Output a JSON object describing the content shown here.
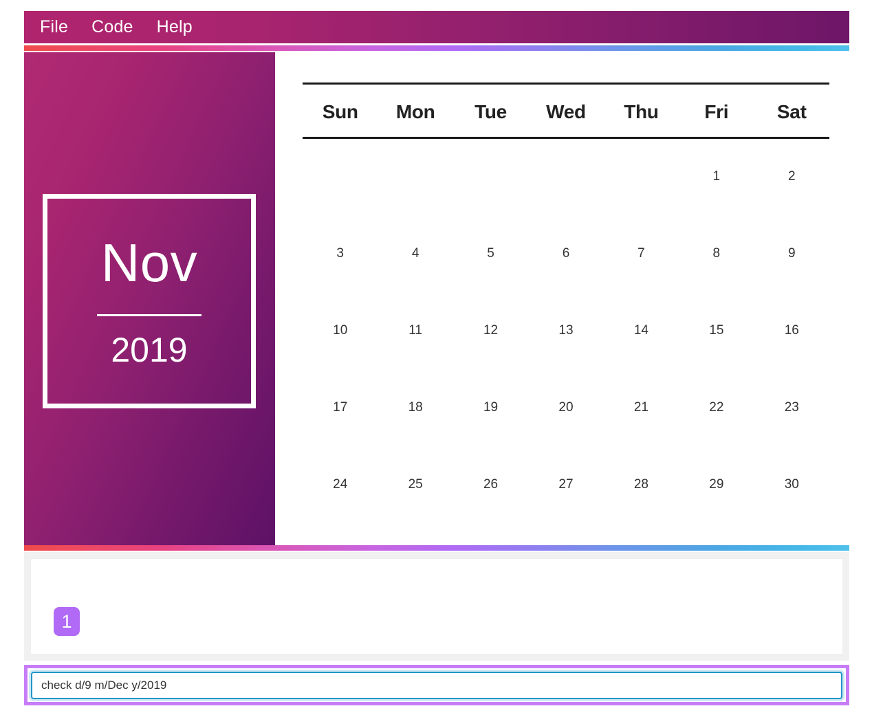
{
  "menubar": {
    "items": [
      {
        "label": "File"
      },
      {
        "label": "Code"
      },
      {
        "label": "Help"
      }
    ]
  },
  "sidebar": {
    "month": "Nov",
    "year": "2019"
  },
  "calendar": {
    "weekday_headers": [
      "Sun",
      "Mon",
      "Tue",
      "Wed",
      "Thu",
      "Fri",
      "Sat"
    ],
    "weeks": [
      [
        "",
        "",
        "",
        "",
        "",
        "1",
        "2"
      ],
      [
        "3",
        "4",
        "5",
        "6",
        "7",
        "8",
        "9"
      ],
      [
        "10",
        "11",
        "12",
        "13",
        "14",
        "15",
        "16"
      ],
      [
        "17",
        "18",
        "19",
        "20",
        "21",
        "22",
        "23"
      ],
      [
        "24",
        "25",
        "26",
        "27",
        "28",
        "29",
        "30"
      ]
    ]
  },
  "output": {
    "badge": "1"
  },
  "command": {
    "value": "check d/9 m/Dec y/2019",
    "placeholder": ""
  },
  "colors": {
    "menubar_start": "#b0246e",
    "menubar_end": "#6e1668",
    "sidebar_start": "#b02a73",
    "sidebar_end": "#5d1266",
    "gradient_red": "#ef4b4b",
    "gradient_purple": "#b06af5",
    "gradient_blue": "#4fc0ea",
    "badge_purple": "#b06af5",
    "input_border": "#2196c9",
    "input_highlight": "#c77df7"
  }
}
